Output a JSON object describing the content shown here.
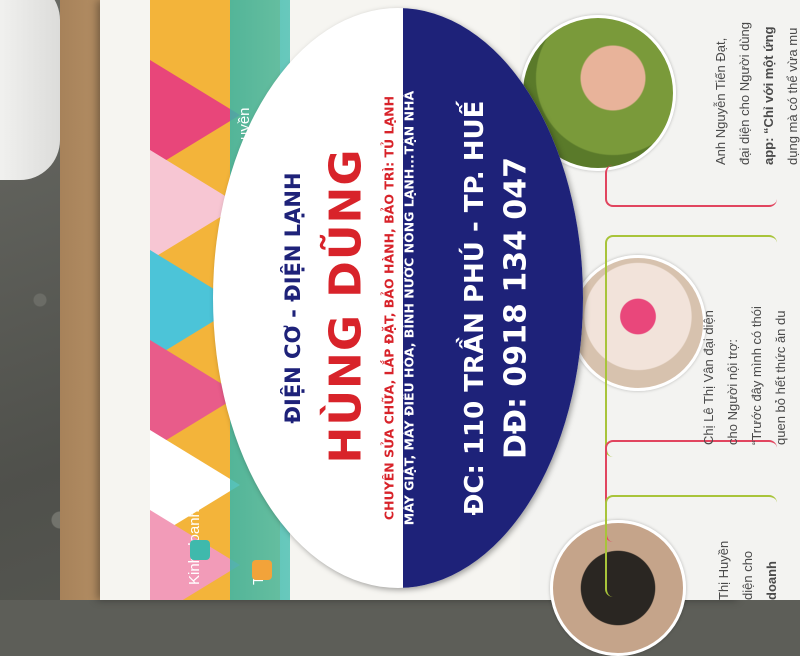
{
  "flyer": {
    "banner_texts": [
      "Kinh doanh đi",
      "Tr",
      "uyền"
    ],
    "testimonials": [
      {
        "lines": [
          "Anh Nguyễn Tiến Đạt,",
          "đại diện cho Người dùng",
          "app: “Chỉ với một ứng",
          "dụng mà có thể vừa mu"
        ]
      },
      {
        "lines": [
          "Chị Lê Thị Vân đại diện",
          "cho Người nội trợ:",
          "“Trước đây mình có thói",
          "quen bỏ hết thức ăn du"
        ]
      },
      {
        "lines": [
          "Thị Huyền",
          "diện cho",
          "doanh"
        ]
      }
    ]
  },
  "sticker": {
    "header": "ĐIỆN CƠ - ĐIỆN LẠNH",
    "shop_name": "HÙNG DŨNG",
    "services_line1": "CHUYÊN SỬA CHỮA, LẮP ĐẶT, BẢO HÀNH, BẢO TRÌ: TỦ LẠNH",
    "services_line2": "MÁY GIẶT, MÁY ĐIỀU HÒA, BÌNH NƯỚC NÓNG LẠNH...TẬN NHÀ",
    "address": "ĐC: 110 TRẦN PHÚ - TP. HUẾ",
    "phone": "DĐ: 0918 134 047"
  },
  "colors": {
    "navy": "#1e2279",
    "red": "#d8232a",
    "white": "#ffffff",
    "teal": "#3fb9ac"
  }
}
